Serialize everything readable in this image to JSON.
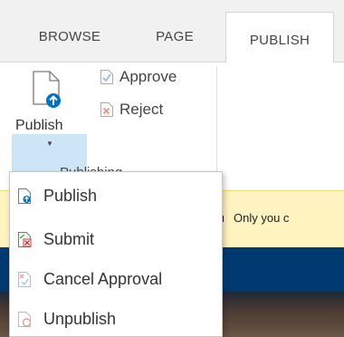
{
  "tabs": {
    "browse": "BROWSE",
    "page": "PAGE",
    "publish": "PUBLISH"
  },
  "ribbon": {
    "publish_label": "Publish",
    "approve_label": "Approve",
    "reject_label": "Reject",
    "group_label": "Publishing"
  },
  "menu": {
    "items": [
      {
        "label": "Publish",
        "icon": "publish-page-icon"
      },
      {
        "label": "Submit",
        "icon": "submit-page-icon"
      },
      {
        "label": "Cancel Approval",
        "icon": "cancel-approval-icon"
      },
      {
        "label": "Unpublish",
        "icon": "unpublish-page-icon"
      }
    ]
  },
  "status": {
    "bold_text": "ou",
    "message": "Only you c"
  },
  "colors": {
    "accent_blue": "#0072c6",
    "dropdown_highlight": "#cde6f7",
    "status_bg": "#fff3bf",
    "suite_bar": "#003a70"
  }
}
